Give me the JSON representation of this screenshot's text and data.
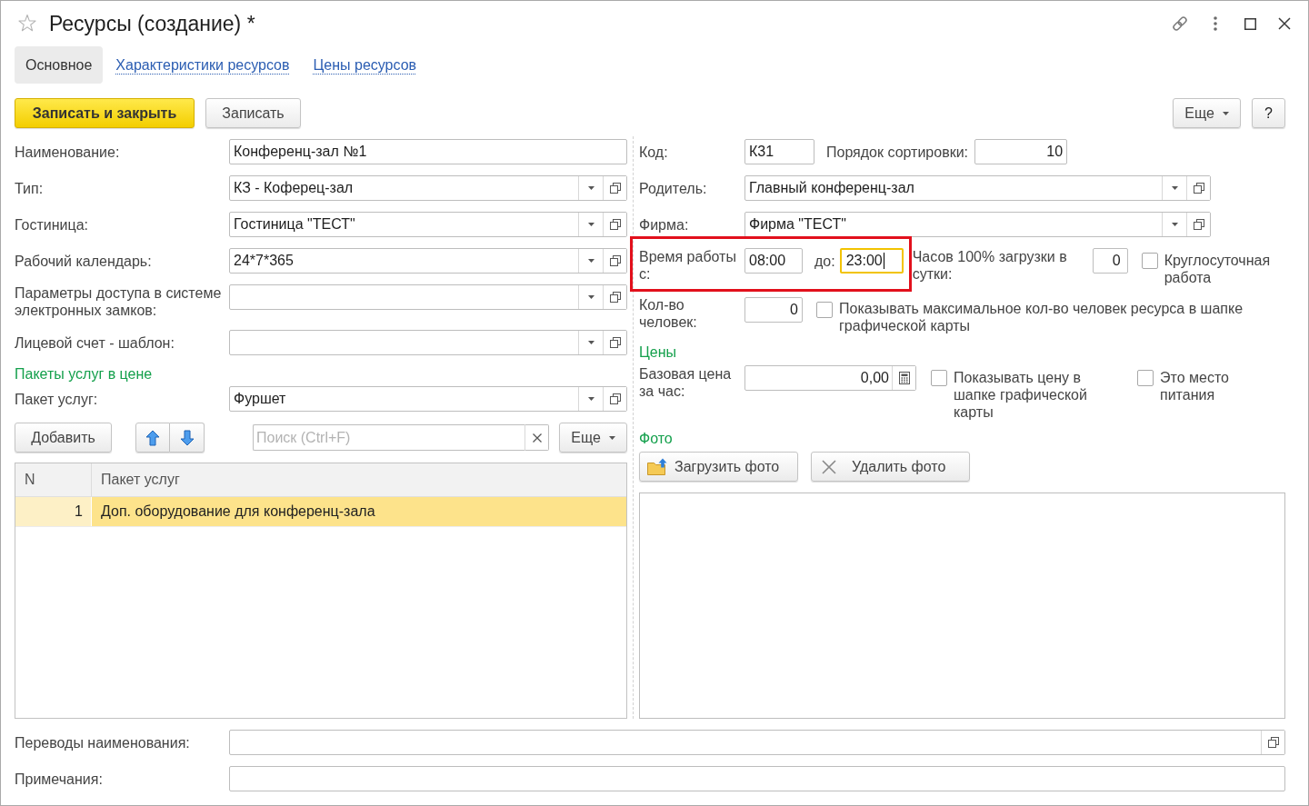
{
  "window": {
    "title": "Ресурсы (создание) *",
    "favorite": false
  },
  "tabs": [
    {
      "label": "Основное",
      "selected": true
    },
    {
      "label": "Характеристики ресурсов",
      "selected": false
    },
    {
      "label": "Цены ресурсов",
      "selected": false
    }
  ],
  "command_bar": {
    "save_and_close": "Записать и закрыть",
    "save": "Записать",
    "more": "Еще",
    "help": "?"
  },
  "left_fields": [
    {
      "kind": "text",
      "label": "Наименование:",
      "value": "Конференц-зал №1"
    },
    {
      "kind": "select",
      "label": "Тип:",
      "value": "КЗ - Коферец-зал"
    },
    {
      "kind": "select",
      "label": "Гостиница:",
      "value": "Гостиница \"ТЕСТ\""
    },
    {
      "kind": "select",
      "label": "Рабочий календарь:",
      "value": "24*7*365"
    },
    {
      "kind": "select",
      "label": "Параметры доступа в системе электронных замков:"
    },
    {
      "kind": "select",
      "label": "Лицевой счет - шаблон:"
    }
  ],
  "packages": {
    "title": "Пакеты услуг в цене",
    "field": {
      "label": "Пакет услуг:",
      "value": "Фуршет"
    },
    "toolbar": {
      "add": "Добавить",
      "search_placeholder": "Поиск (Ctrl+F)",
      "more": "Еще"
    },
    "table": {
      "columns": [
        "N",
        "Пакет услуг"
      ],
      "rows": [
        {
          "cells": [
            "1",
            "Доп. оборудование для конференц-зала"
          ],
          "selected": true
        }
      ]
    }
  },
  "right": {
    "code": {
      "label": "Код:",
      "value": "К31"
    },
    "sort_order": {
      "label": "Порядок сортировки:",
      "value": "10"
    },
    "fields": [
      {
        "label": "Родитель:",
        "value": "Главный конференц-зал"
      },
      {
        "label": "Фирма:",
        "value": "Фирма \"ТЕСТ\""
      }
    ],
    "work_time": {
      "label": "Время работы с:",
      "from": "08:00",
      "to_label": "до:",
      "to": "23:00",
      "to_focused": true,
      "highlighted": true
    },
    "full_load_hours": {
      "label": "Часов 100% загрузки в сутки:",
      "value": "0"
    },
    "round_the_clock": {
      "label": "Круглосуточная работа",
      "checked": false
    },
    "people_count": {
      "label": "Кол-во человек:",
      "value": "0"
    },
    "show_max_people": {
      "label": "Показывать максимальное кол-во человек ресурса в шапке графической карты",
      "checked": false
    },
    "prices_title": "Цены",
    "base_price": {
      "label": "Базовая цена за час:",
      "value": "0,00"
    },
    "show_price": {
      "label": "Показывать цену в шапке графической карты",
      "checked": false
    },
    "food_place": {
      "label": "Это место питания",
      "checked": false
    },
    "photo_title": "Фото",
    "upload_photo": "Загрузить фото",
    "delete_photo": "Удалить фото"
  },
  "bottom_fields": [
    {
      "kind": "open",
      "label": "Переводы наименования:"
    },
    {
      "kind": "text",
      "label": "Примечания:"
    }
  ]
}
